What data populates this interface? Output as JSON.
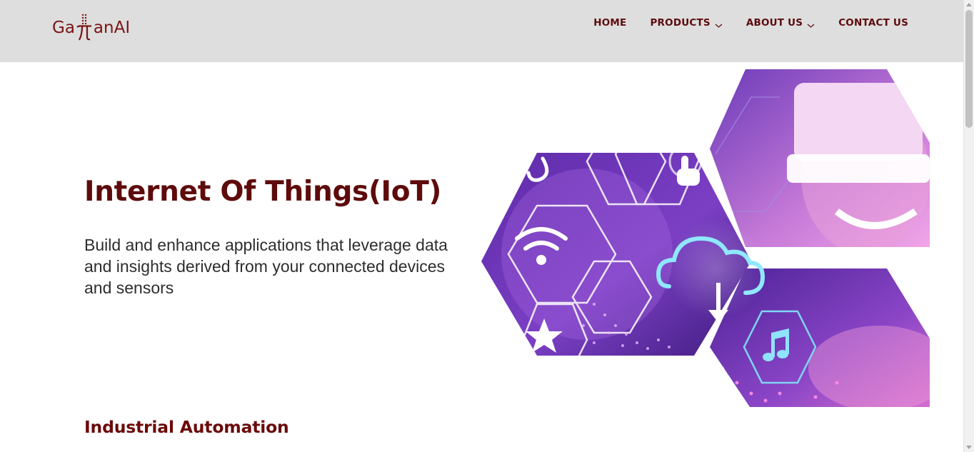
{
  "logo": {
    "text_before": "Ga",
    "text_after": "anAI"
  },
  "nav": {
    "home": "HOME",
    "products": "PRODUCTS",
    "about": "ABOUT US",
    "contact": "CONTACT US"
  },
  "hero": {
    "title": "Internet Of Things(IoT)",
    "description": "Build and enhance applications that leverage data and insights derived from your connected devices and sensors"
  },
  "section": {
    "title": "Industrial Automation"
  },
  "colors": {
    "brand": "#5e0b0b",
    "header_bg": "#dedede",
    "purple": "#7b3fc4",
    "pink": "#e58ee0"
  }
}
